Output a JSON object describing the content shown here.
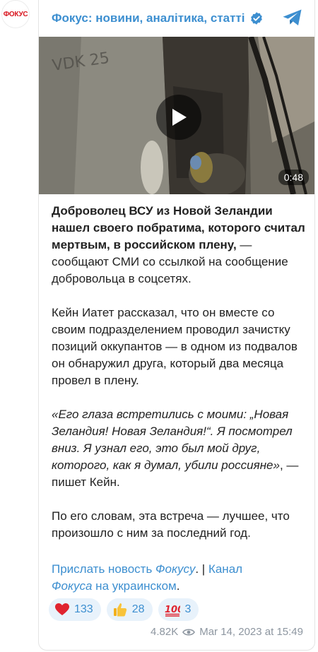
{
  "avatar": {
    "text": "ФОКУС"
  },
  "header": {
    "channel_name": "Фокус: новини, аналітика, статті"
  },
  "video": {
    "duration": "0:48",
    "watermark": "VDK 25"
  },
  "post": {
    "p1_bold": "Доброволец ВСУ из Новой Зеландии нашел своего побратима, которого считал мертвым, в российском плену,",
    "p1_rest": " — сообщают СМИ со ссылкой на сообщение добровольца в соцсетях.",
    "p2": "Кейн Иатет рассказал, что он вместе со своим подразделением проводил зачистку позиций оккупантов — в одном из подвалов он обнаружил друга, который два месяца провел в плену.",
    "p3_italic": "«Его глаза встретились с моими: „Новая Зеландия! Новая Зеландия!“. Я посмотрел вниз. Я узнал его, это был мой друг, которого, как я думал, убили россияне»",
    "p3_rest": ", — пишет Кейн.",
    "p4": "По его словам, эта встреча — лучшее, что произошло с ним за последний год."
  },
  "links": {
    "send_news": "Прислать новость ",
    "send_news_italic": "Фокусу",
    "separator": ". | ",
    "channel": "Канал ",
    "channel_italic": "Фокуса",
    "channel_rest": " на украинском",
    "end": "."
  },
  "reactions": [
    {
      "emoji": "heart-icon",
      "count": "133"
    },
    {
      "emoji": "thumbs-up-icon",
      "count": "28"
    },
    {
      "emoji": "hundred-icon",
      "count": "3"
    }
  ],
  "meta": {
    "views": "4.82K",
    "date": "Mar 14, 2023 at 15:49"
  },
  "colors": {
    "link": "#3d8fd0",
    "reaction_bg": "#e8f2fb",
    "brand_red": "#d8141d"
  }
}
